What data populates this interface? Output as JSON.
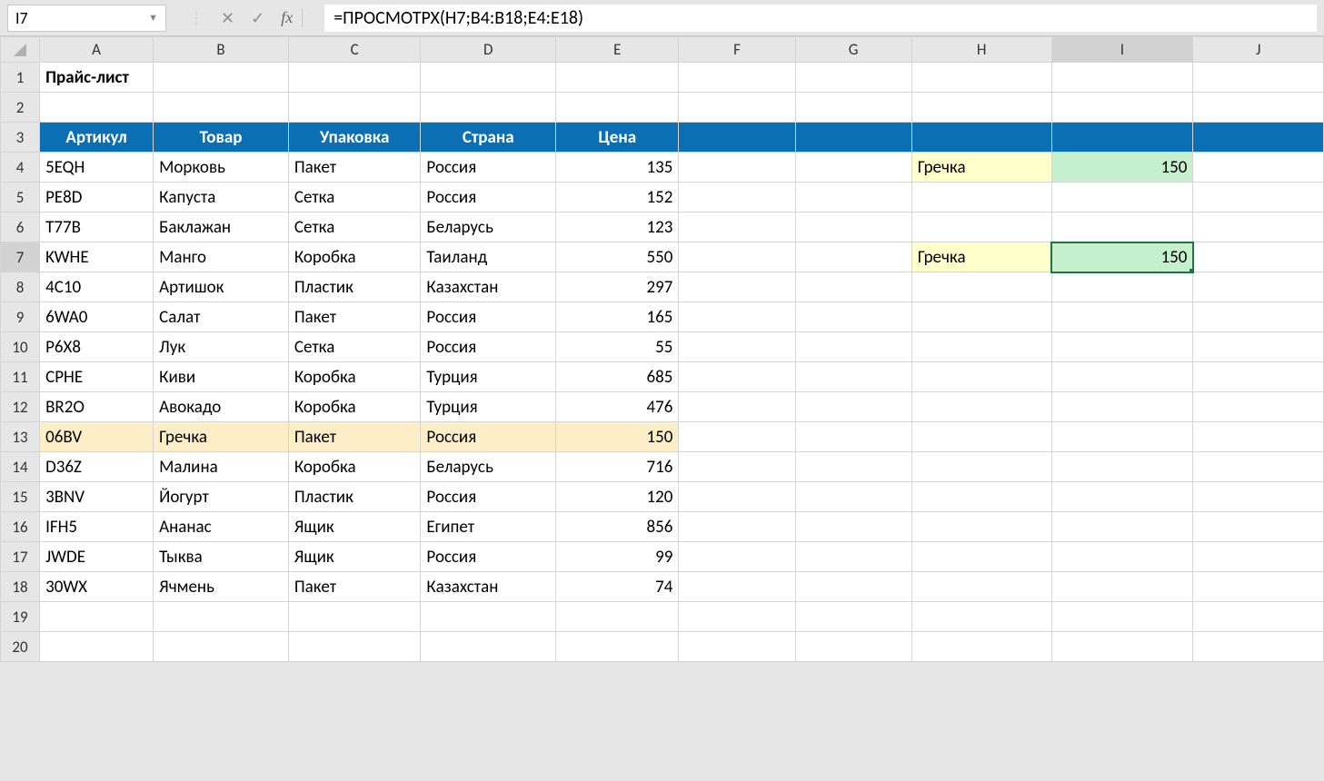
{
  "formula_bar": {
    "cell_ref": "I7",
    "fx_label": "fx",
    "formula": "=ПРОСМОТРХ(H7;B4:B18;E4:E18)"
  },
  "columns": [
    "A",
    "B",
    "C",
    "D",
    "E",
    "F",
    "G",
    "H",
    "I",
    "J"
  ],
  "row_count": 20,
  "selected_col": "I",
  "selected_row": 7,
  "title": "Прайс-лист",
  "table_headers": {
    "A": "Артикул",
    "B": "Товар",
    "C": "Упаковка",
    "D": "Страна",
    "E": "Цена"
  },
  "table_rows": [
    {
      "A": "5EQH",
      "B": "Морковь",
      "C": "Пакет",
      "D": "Россия",
      "E": 135
    },
    {
      "A": "PE8D",
      "B": "Капуста",
      "C": "Сетка",
      "D": "Россия",
      "E": 152
    },
    {
      "A": "T77B",
      "B": "Баклажан",
      "C": "Сетка",
      "D": "Беларусь",
      "E": 123
    },
    {
      "A": "KWHE",
      "B": "Манго",
      "C": "Коробка",
      "D": "Таиланд",
      "E": 550
    },
    {
      "A": "4C10",
      "B": "Артишок",
      "C": "Пластик",
      "D": "Казахстан",
      "E": 297
    },
    {
      "A": "6WA0",
      "B": "Салат",
      "C": "Пакет",
      "D": "Россия",
      "E": 165
    },
    {
      "A": "P6X8",
      "B": "Лук",
      "C": "Сетка",
      "D": "Россия",
      "E": 55
    },
    {
      "A": "CPHE",
      "B": "Киви",
      "C": "Коробка",
      "D": "Турция",
      "E": 685
    },
    {
      "A": "BR2O",
      "B": "Авокадо",
      "C": "Коробка",
      "D": "Турция",
      "E": 476
    },
    {
      "A": "06BV",
      "B": "Гречка",
      "C": "Пакет",
      "D": "Россия",
      "E": 150
    },
    {
      "A": "D36Z",
      "B": "Малина",
      "C": "Коробка",
      "D": "Беларусь",
      "E": 716
    },
    {
      "A": "3BNV",
      "B": "Йогурт",
      "C": "Пластик",
      "D": "Россия",
      "E": 120
    },
    {
      "A": "IFH5",
      "B": "Ананас",
      "C": "Ящик",
      "D": "Египет",
      "E": 856
    },
    {
      "A": "JWDE",
      "B": "Тыква",
      "C": "Ящик",
      "D": "Россия",
      "E": 99
    },
    {
      "A": "30WX",
      "B": "Ячмень",
      "C": "Пакет",
      "D": "Казахстан",
      "E": 74
    }
  ],
  "highlight_row_index": 9,
  "lookup_cells": {
    "H4": "Гречка",
    "I4": 150,
    "H7": "Гречка",
    "I7": 150
  }
}
